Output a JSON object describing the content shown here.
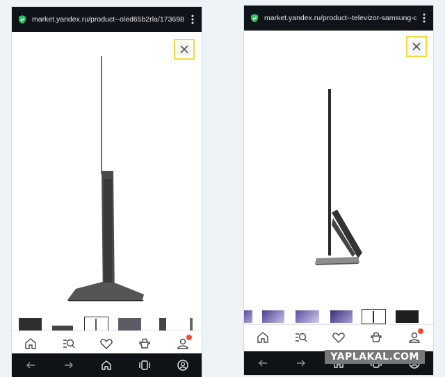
{
  "left_phone": {
    "url": "market.yandex.ru/product--oled65b2rla/173698",
    "product_image": "tv-side-view-oled",
    "close_icon": "close-icon",
    "thumbnails": [
      "thumb-1",
      "thumb-2",
      "thumb-3",
      "thumb-4",
      "thumb-5",
      "thumb-6"
    ],
    "nav": [
      "home-icon",
      "catalog-search-icon",
      "heart-icon",
      "cart-icon",
      "profile-icon"
    ],
    "system": [
      "back-arrow-icon",
      "forward-arrow-icon",
      "home-icon",
      "tabs-icon",
      "account-icon"
    ]
  },
  "right_phone": {
    "url": "market.yandex.ru/product--televizor-samsung-q",
    "product_image": "tv-side-view-samsung",
    "close_icon": "close-icon",
    "thumbnails": [
      "thumb-1",
      "thumb-2",
      "thumb-3",
      "thumb-4",
      "thumb-5",
      "thumb-6"
    ],
    "nav": [
      "home-icon",
      "catalog-search-icon",
      "heart-icon",
      "cart-icon",
      "profile-icon"
    ],
    "system": [
      "back-arrow-icon",
      "forward-arrow-icon",
      "home-icon",
      "tabs-icon",
      "account-icon"
    ]
  },
  "watermark": "YAPLAKAL.COM",
  "colors": {
    "highlight": "#f4d93a",
    "badge": "#f0492b",
    "bar": "#0f141a"
  }
}
